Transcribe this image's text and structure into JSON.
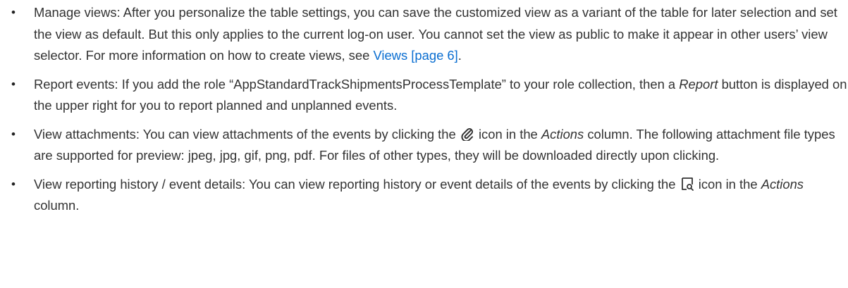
{
  "items": [
    {
      "title": "Manage views",
      "text_a": "After you personalize the table settings, you can save the customized view as a variant of the table for later selection and set the view as default. But this only applies to the current log-on user. You cannot set the view as public to make it appear in other users’ view selector. For more information on how to create views, see ",
      "link": "Views [page 6]",
      "text_b": "."
    },
    {
      "title": "Report events",
      "text_a": "If you add the role “AppStandardTrackShipmentsProcessTemplate” to your role collection, then a ",
      "em": "Report",
      "text_b": " button is displayed on the upper right for you to report planned and unplanned events."
    },
    {
      "title": "View attachments",
      "text_a": "You can view attachments of the events by clicking the ",
      "icon": "paperclip-icon",
      "text_b": " icon in the ",
      "em": "Actions",
      "text_c": " column. The following attachment file types are supported for preview: jpeg, jpg, gif, png, pdf. For files of other types, they will be downloaded directly upon clicking."
    },
    {
      "title": "View reporting history / event details",
      "text_a": "You can view reporting history or event details of the events by clicking the ",
      "icon": "document-search-icon",
      "text_b": " icon in the ",
      "em": "Actions",
      "text_c": " column."
    }
  ],
  "colors": {
    "text": "#333333",
    "link": "#0a6ed1"
  }
}
